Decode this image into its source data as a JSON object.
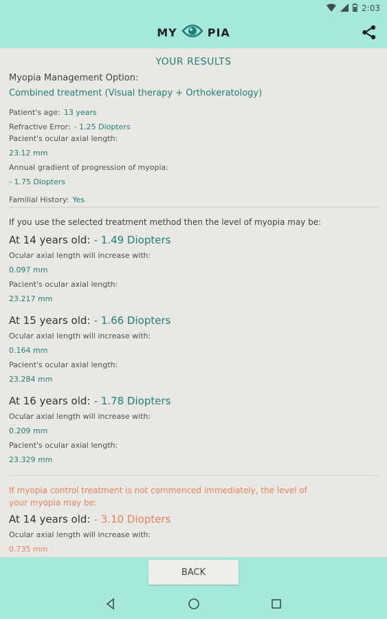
{
  "status": {
    "time": "2:03"
  },
  "app": {
    "logo_left": "MY",
    "logo_right": "PIA"
  },
  "results": {
    "title": "YOUR RESULTS",
    "option_label": "Myopia Management Option:",
    "option_value": "Combined treatment (Visual therapy + Orthokeratology)",
    "age_label": "Patient's age:",
    "age_value": "13 years",
    "refr_label": "Refractive Error:",
    "refr_value": "- 1.25 Diopters",
    "axial_label": "Pacient's ocular axial length:",
    "axial_value": "23.12 mm",
    "gradient_label": "Annual gradient of progression of myopia:",
    "gradient_value": "- 1.75 Diopters",
    "familial_label": "Familial History:",
    "familial_value": "Yes"
  },
  "treated": {
    "intro": "If you use the selected treatment method then the level of myopia may be:",
    "items": [
      {
        "age": "At 14 years old:",
        "diopters": "- 1.49 Diopters",
        "inc_label": "Ocular axial length will increase with:",
        "inc_value": "0.097 mm",
        "len_label": "Pacient's ocular axial length:",
        "len_value": "23.217 mm"
      },
      {
        "age": "At 15 years old:",
        "diopters": "- 1.66 Diopters",
        "inc_label": "Ocular axial length will increase with:",
        "inc_value": "0.164 mm",
        "len_label": "Pacient's ocular axial length:",
        "len_value": "23.284 mm"
      },
      {
        "age": "At 16 years old:",
        "diopters": "- 1.78 Diopters",
        "inc_label": "Ocular axial length will increase with:",
        "inc_value": "0.209 mm",
        "len_label": "Pacient's ocular axial length:",
        "len_value": "23.329 mm"
      }
    ]
  },
  "untreated": {
    "intro_line1": "If myopia control treatment is not commenced immediately, the level of",
    "intro_line2": "your myopia may be:",
    "items": [
      {
        "age": "At 14 years old:",
        "diopters": "- 3.10 Diopters",
        "inc_label": "Ocular axial length will increase with:",
        "inc_value": "0.735 mm"
      }
    ]
  },
  "actions": {
    "back_label": "BACK"
  },
  "colors": {
    "accent": "#a7e8dc",
    "teal_text": "#1f7f76",
    "warning_text": "#e4845f",
    "background": "#e9e8e4"
  },
  "icons": {
    "share": "share-icon",
    "eye": "eye-logo-icon"
  }
}
